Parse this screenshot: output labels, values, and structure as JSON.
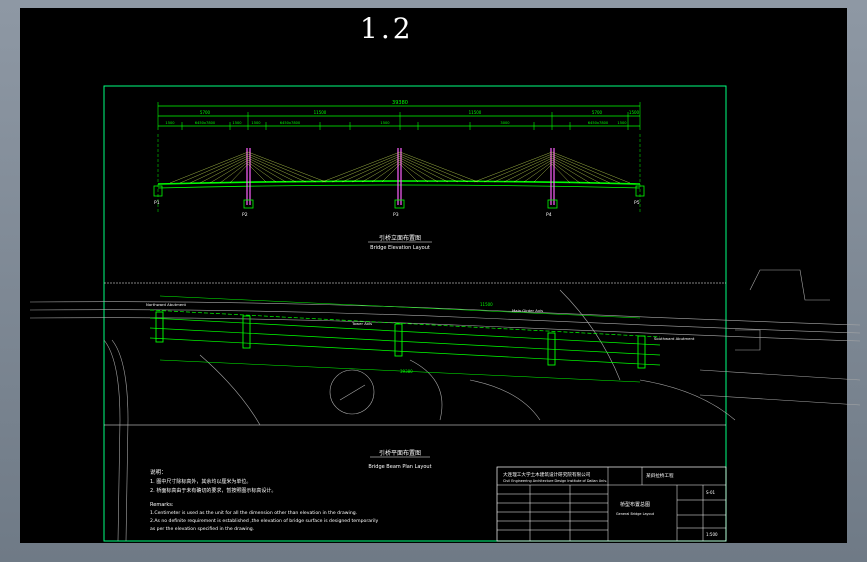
{
  "page_number": "1.2",
  "elevation": {
    "overall_length": "39380",
    "spans_top": [
      "5700",
      "11500",
      "11500",
      "5700",
      "1500"
    ],
    "spans_detail": [
      "1500",
      "6450x7800",
      "1500",
      "1500",
      "6450x7800",
      "1500",
      "3000",
      "6450x7800",
      "1500"
    ],
    "pier_labels": [
      "P1",
      "P2",
      "P3",
      "P4",
      "P5"
    ],
    "title_cn": "引桥立面布置图",
    "title_en": "Bridge Elevation Layout"
  },
  "plan": {
    "dimension_top": "11500",
    "dimension_bottom": "39380",
    "label_left": "Northward Abutment",
    "label_right": "Southward Abutment",
    "label_mid1": "Tower Axis",
    "label_mid2": "Main Girder Axis",
    "title_cn": "引桥平面布置图",
    "title_en": "Bridge Beam Plan Layout"
  },
  "notes": {
    "heading_cn": "说明：",
    "cn_lines": [
      "1. 图中尺寸除标高外，其余均以厘米为单位。",
      "2. 桥面标高由于未有确切的要求，暂按照图示标高设计。"
    ],
    "heading_en": "Remarks:",
    "en_lines": [
      "1.Centimeter is used as the unit for all the dimension other than elevation in the drawing.",
      "2.As no definite requirement is established ,the elevation of bridge surface is designed temporarily",
      "  as per the elevation specified in the drawing."
    ]
  },
  "title_block": {
    "institute": "大连理工大学土木建筑设计研究院有限公司",
    "institute_en": "Civil Engineering Architecture Design Institute of Dalian Univ.",
    "project": "某斜拉桥工程",
    "drawing_name": "桥型布置总图",
    "drawing_name_en": "General Bridge Layout",
    "drawing_no": "S-01",
    "scale": "1:500"
  },
  "colors": {
    "background": "#000000",
    "frame": "#00ff80",
    "structure": "#00ff00",
    "cables": "#e0ff60",
    "text": "#ffffff",
    "map": "#c8c8c8"
  }
}
